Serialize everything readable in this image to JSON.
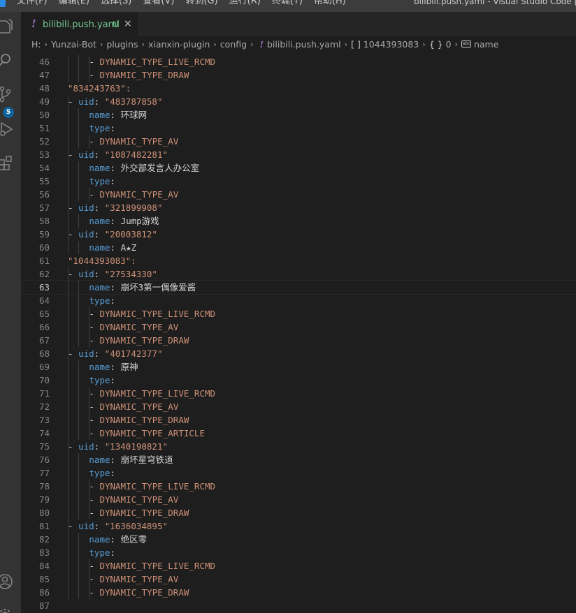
{
  "titlebar": {
    "menu": [
      "文件(F)",
      "编辑(E)",
      "选择(S)",
      "查看(V)",
      "转到(G)",
      "运行(R)",
      "终端(T)",
      "帮助(H)"
    ],
    "window_title": "bilibili.push.yaml - Visual Studio Code [管理员]"
  },
  "activitybar": {
    "icons": [
      "explorer-icon",
      "search-icon",
      "source-control-icon",
      "run-debug-icon",
      "extensions-icon",
      "account-icon",
      "settings-gear-icon"
    ],
    "scm_badge": "5"
  },
  "tab": {
    "label": "bilibili.push.yaml",
    "status": "U",
    "close": "×"
  },
  "breadcrumb": {
    "drive": "H:",
    "folders": [
      "Yunzai-Bot",
      "plugins",
      "xianxin-plugin",
      "config"
    ],
    "file": "bilibili.push.yaml",
    "symbols": [
      {
        "icon": "[ ]",
        "label": "1044393083"
      },
      {
        "icon": "{ }",
        "label": "0"
      },
      {
        "icon": "abc",
        "label": "name"
      }
    ]
  },
  "editor": {
    "current_line": 63,
    "lines": [
      {
        "n": 46,
        "indent": 3,
        "dash": true,
        "key": "",
        "value": "DYNAMIC_TYPE_LIVE_RCMD",
        "quoted": false
      },
      {
        "n": 47,
        "indent": 3,
        "dash": true,
        "key": "",
        "value": "DYNAMIC_TYPE_DRAW",
        "quoted": false
      },
      {
        "n": 48,
        "indent": 0,
        "dash": false,
        "key": "",
        "value": "\"834243763\":",
        "quoted": true
      },
      {
        "n": 49,
        "indent": 1,
        "dash": true,
        "key": "uid",
        "value": "\"483787858\"",
        "quoted": true
      },
      {
        "n": 50,
        "indent": 2,
        "dash": false,
        "key": "name",
        "value": "环球网",
        "quoted": false
      },
      {
        "n": 51,
        "indent": 2,
        "dash": false,
        "key": "type",
        "value": "",
        "quoted": false
      },
      {
        "n": 52,
        "indent": 3,
        "dash": true,
        "key": "",
        "value": "DYNAMIC_TYPE_AV",
        "quoted": false
      },
      {
        "n": 53,
        "indent": 1,
        "dash": true,
        "key": "uid",
        "value": "\"1087482281\"",
        "quoted": true
      },
      {
        "n": 54,
        "indent": 2,
        "dash": false,
        "key": "name",
        "value": "外交部发言人办公室",
        "quoted": false
      },
      {
        "n": 55,
        "indent": 2,
        "dash": false,
        "key": "type",
        "value": "",
        "quoted": false
      },
      {
        "n": 56,
        "indent": 3,
        "dash": true,
        "key": "",
        "value": "DYNAMIC_TYPE_AV",
        "quoted": false
      },
      {
        "n": 57,
        "indent": 1,
        "dash": true,
        "key": "uid",
        "value": "\"321899908\"",
        "quoted": true
      },
      {
        "n": 58,
        "indent": 2,
        "dash": false,
        "key": "name",
        "value": "Jump游戏",
        "quoted": false
      },
      {
        "n": 59,
        "indent": 1,
        "dash": true,
        "key": "uid",
        "value": "\"20003812\"",
        "quoted": true
      },
      {
        "n": 60,
        "indent": 2,
        "dash": false,
        "key": "name",
        "value": "A★Z",
        "quoted": false
      },
      {
        "n": 61,
        "indent": 0,
        "dash": false,
        "key": "",
        "value": "\"1044393083\":",
        "quoted": true
      },
      {
        "n": 62,
        "indent": 1,
        "dash": true,
        "key": "uid",
        "value": "\"27534330\"",
        "quoted": true
      },
      {
        "n": 63,
        "indent": 2,
        "dash": false,
        "key": "name",
        "value": "崩坏3第一偶像爱酱",
        "quoted": false
      },
      {
        "n": 64,
        "indent": 2,
        "dash": false,
        "key": "type",
        "value": "",
        "quoted": false
      },
      {
        "n": 65,
        "indent": 3,
        "dash": true,
        "key": "",
        "value": "DYNAMIC_TYPE_LIVE_RCMD",
        "quoted": false
      },
      {
        "n": 66,
        "indent": 3,
        "dash": true,
        "key": "",
        "value": "DYNAMIC_TYPE_AV",
        "quoted": false
      },
      {
        "n": 67,
        "indent": 3,
        "dash": true,
        "key": "",
        "value": "DYNAMIC_TYPE_DRAW",
        "quoted": false
      },
      {
        "n": 68,
        "indent": 1,
        "dash": true,
        "key": "uid",
        "value": "\"401742377\"",
        "quoted": true
      },
      {
        "n": 69,
        "indent": 2,
        "dash": false,
        "key": "name",
        "value": "原神",
        "quoted": false
      },
      {
        "n": 70,
        "indent": 2,
        "dash": false,
        "key": "type",
        "value": "",
        "quoted": false
      },
      {
        "n": 71,
        "indent": 3,
        "dash": true,
        "key": "",
        "value": "DYNAMIC_TYPE_LIVE_RCMD",
        "quoted": false
      },
      {
        "n": 72,
        "indent": 3,
        "dash": true,
        "key": "",
        "value": "DYNAMIC_TYPE_AV",
        "quoted": false
      },
      {
        "n": 73,
        "indent": 3,
        "dash": true,
        "key": "",
        "value": "DYNAMIC_TYPE_DRAW",
        "quoted": false
      },
      {
        "n": 74,
        "indent": 3,
        "dash": true,
        "key": "",
        "value": "DYNAMIC_TYPE_ARTICLE",
        "quoted": false
      },
      {
        "n": 75,
        "indent": 1,
        "dash": true,
        "key": "uid",
        "value": "\"1340190821\"",
        "quoted": true
      },
      {
        "n": 76,
        "indent": 2,
        "dash": false,
        "key": "name",
        "value": "崩坏星穹铁道",
        "quoted": false
      },
      {
        "n": 77,
        "indent": 2,
        "dash": false,
        "key": "type",
        "value": "",
        "quoted": false
      },
      {
        "n": 78,
        "indent": 3,
        "dash": true,
        "key": "",
        "value": "DYNAMIC_TYPE_LIVE_RCMD",
        "quoted": false
      },
      {
        "n": 79,
        "indent": 3,
        "dash": true,
        "key": "",
        "value": "DYNAMIC_TYPE_AV",
        "quoted": false
      },
      {
        "n": 80,
        "indent": 3,
        "dash": true,
        "key": "",
        "value": "DYNAMIC_TYPE_DRAW",
        "quoted": false
      },
      {
        "n": 81,
        "indent": 1,
        "dash": true,
        "key": "uid",
        "value": "\"1636034895\"",
        "quoted": true
      },
      {
        "n": 82,
        "indent": 2,
        "dash": false,
        "key": "name",
        "value": "绝区零",
        "quoted": false
      },
      {
        "n": 83,
        "indent": 2,
        "dash": false,
        "key": "type",
        "value": "",
        "quoted": false
      },
      {
        "n": 84,
        "indent": 3,
        "dash": true,
        "key": "",
        "value": "DYNAMIC_TYPE_LIVE_RCMD",
        "quoted": false
      },
      {
        "n": 85,
        "indent": 3,
        "dash": true,
        "key": "",
        "value": "DYNAMIC_TYPE_AV",
        "quoted": false
      },
      {
        "n": 86,
        "indent": 3,
        "dash": true,
        "key": "",
        "value": "DYNAMIC_TYPE_DRAW",
        "quoted": false
      },
      {
        "n": 87,
        "indent": 0,
        "dash": false,
        "key": "",
        "value": "",
        "quoted": false
      }
    ]
  }
}
